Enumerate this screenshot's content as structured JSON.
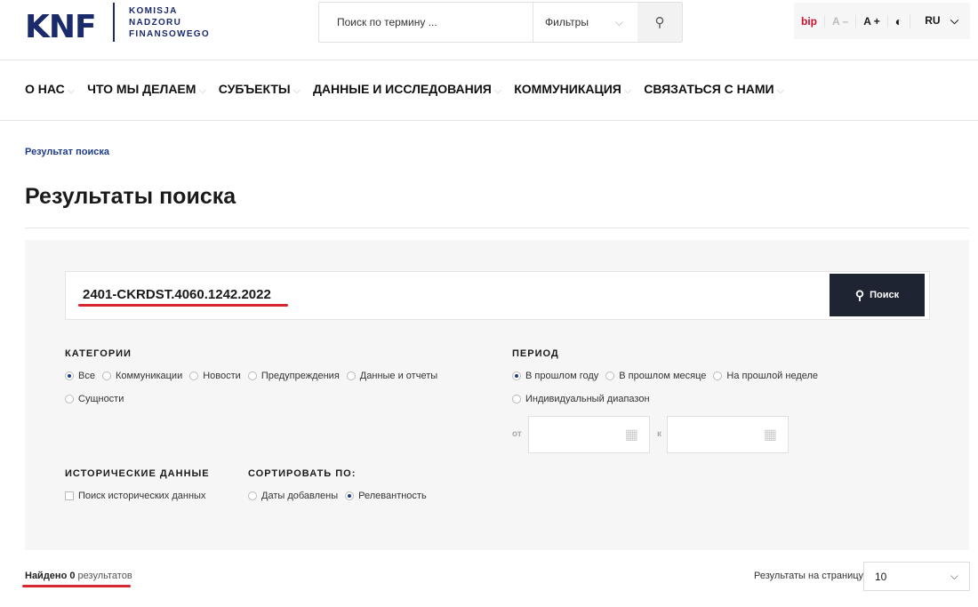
{
  "header": {
    "logo": "KNF",
    "logo_sub": [
      "KOMISJA",
      "NADZORU",
      "FINANSOWEGO"
    ],
    "search_placeholder": "Поиск по термину ...",
    "filters": "Фильтры",
    "bip": "bip",
    "font_minus": "A –",
    "font_plus": "A +",
    "lang": "RU"
  },
  "nav": [
    "О НАС",
    "ЧТО МЫ ДЕЛАЕМ",
    "СУБЪЕКТЫ",
    "ДАННЫЕ И ИССЛЕДОВАНИЯ",
    "КОММУНИКАЦИЯ",
    "СВЯЗАТЬСЯ С НАМИ"
  ],
  "breadcrumb": "Результат поиска",
  "title": "Результаты поиска",
  "search": {
    "value": "2401-CKRDST.4060.1242.2022",
    "button": "Поиск"
  },
  "categories": {
    "label": "КАТЕГОРИИ",
    "options": [
      "Все",
      "Коммуникации",
      "Новости",
      "Предупреждения",
      "Данные и отчеты",
      "Сущности"
    ],
    "selected": 0
  },
  "period": {
    "label": "ПЕРИОД",
    "options": [
      "В прошлом году",
      "В прошлом месяце",
      "На прошлой неделе",
      "Индивидуальный диапазон"
    ],
    "selected": 0,
    "from": "от",
    "to": "к"
  },
  "historical": {
    "label": "ИСТОРИЧЕСКИЕ ДАННЫЕ",
    "checkbox": "Поиск исторических данных"
  },
  "sort": {
    "label": "СОРТИРОВАТЬ ПО:",
    "options": [
      "Даты добавлены",
      "Релевантность"
    ],
    "selected": 1
  },
  "results": {
    "found_prefix": "Найдено",
    "count": "0",
    "suffix": "результатов",
    "per_page_label": "Результаты на страницу",
    "per_page": "10"
  },
  "colors": {
    "brand": "#1b2a6b",
    "accent": "#1e3a8a",
    "button": "#1f2433",
    "annotation": "#d7262f"
  }
}
